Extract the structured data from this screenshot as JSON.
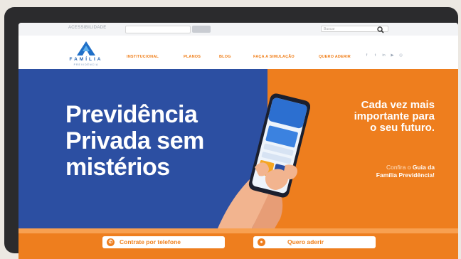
{
  "utility_bar": {
    "label": "ACESSIBILIDADE",
    "search_placeholder": "Buscar"
  },
  "brand": {
    "name": "FAMÍLIA",
    "sub": "PREVIDÊNCIA"
  },
  "nav": {
    "items": [
      {
        "label": "INSTITUCIONAL"
      },
      {
        "label": "PLANOS"
      },
      {
        "label": "BLOG"
      },
      {
        "label": "FAÇA A SIMULAÇÃO"
      },
      {
        "label": "QUERO ADERIR"
      }
    ],
    "social_icons": [
      "facebook-icon",
      "twitter-icon",
      "linkedin-icon",
      "youtube-icon",
      "instagram-icon"
    ]
  },
  "hero": {
    "title_lines": [
      "Previdência",
      "Privada sem",
      "mistérios"
    ],
    "tagline_lines": [
      "Cada vez mais",
      "importante para",
      "o seu futuro."
    ],
    "guide_prefix": "Confira o ",
    "guide_link_1": "Guia da",
    "guide_link_2": "Família Previdência!",
    "slider_count": 3,
    "slider_active": 1
  },
  "cta": {
    "phone_label": "Contrate por telefone",
    "join_label": "Quero aderir"
  },
  "colors": {
    "brand_blue": "#2c4fa2",
    "brand_orange": "#ee7e1e"
  }
}
